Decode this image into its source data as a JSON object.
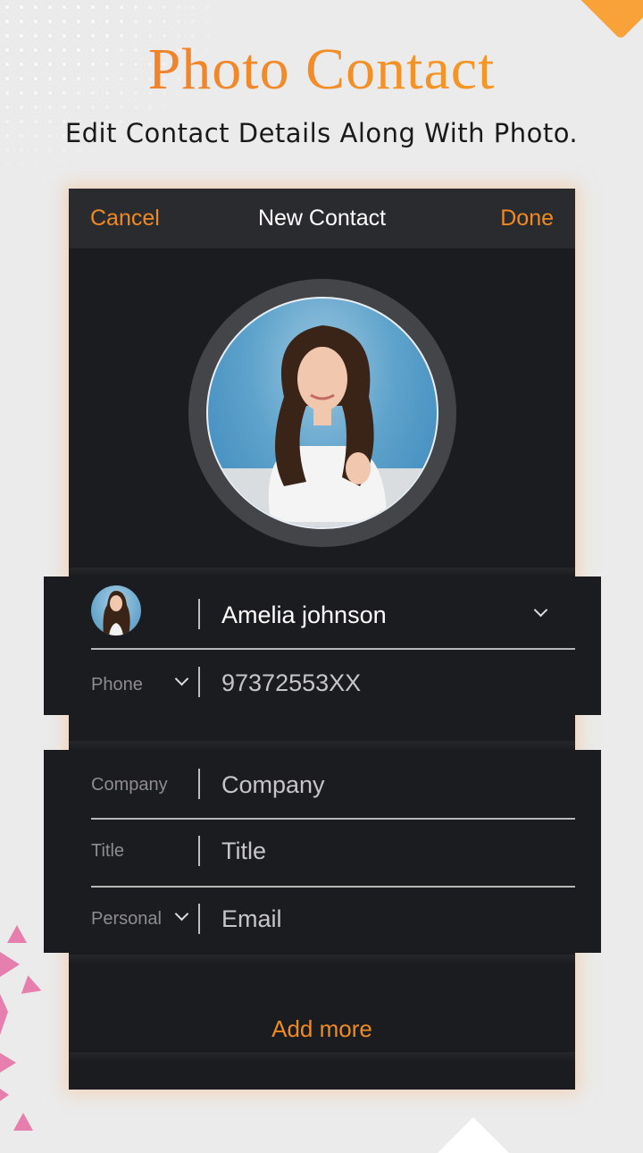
{
  "promo": {
    "headline": "Photo Contact",
    "subheadline": "Edit Contact Details Along With Photo."
  },
  "navbar": {
    "cancel_label": "Cancel",
    "title": "New Contact",
    "done_label": "Done"
  },
  "contact": {
    "name": "Amelia johnson",
    "phone_label": "Phone",
    "phone_value": "97372553XX"
  },
  "details": {
    "company_label": "Company",
    "company_placeholder": "Company",
    "title_label": "Title",
    "title_placeholder": "Title",
    "email_label": "Personal",
    "email_placeholder": "Email"
  },
  "actions": {
    "add_more_label": "Add more"
  },
  "colors": {
    "accent": "#ee8a23",
    "headline_gradient_start": "#ee7a30",
    "headline_gradient_end": "#f6a021",
    "panel_background": "#1b1c20",
    "navbar_background": "#2a2b2f",
    "decor_pink": "#e77fae"
  }
}
